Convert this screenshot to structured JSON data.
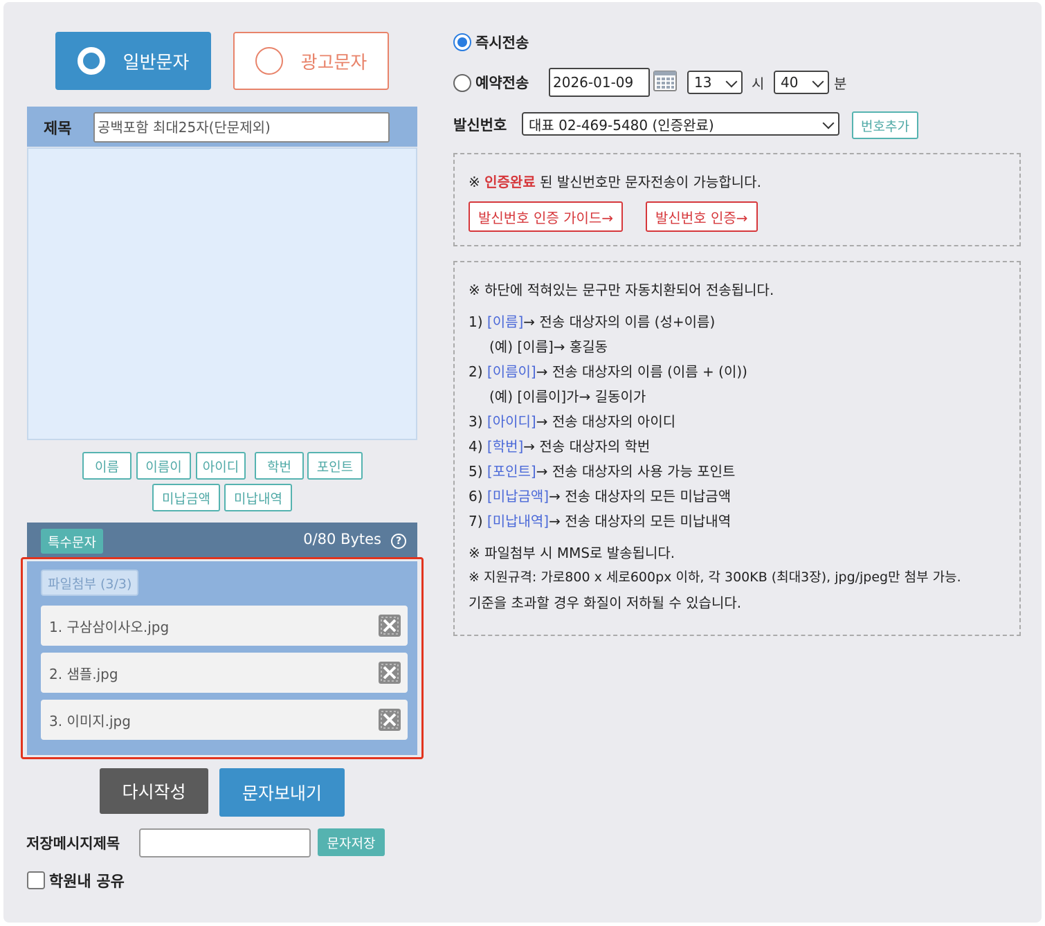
{
  "message_type": {
    "normal_label": "일반문자",
    "ad_label": "광고문자",
    "selected": "일반문자"
  },
  "subject": {
    "label": "제목",
    "placeholder": "공백포함 최대25자(단문제외)"
  },
  "variable_tags": [
    "이름",
    "이름이",
    "아이디",
    "학번",
    "포인트",
    "미납금액",
    "미납내역"
  ],
  "bytes_bar": {
    "special_chars_label": "특수문자",
    "bytes_text": "0/80 Bytes",
    "help_icon": "question-circle-icon"
  },
  "attachments": {
    "badge": "파일첨부 (3/3)",
    "files": [
      "1. 구삼삼이사오.jpg",
      "2. 샘플.jpg",
      "3. 이미지.jpg"
    ],
    "delete_icon": "x-delete-icon"
  },
  "actions": {
    "rewrite_label": "다시작성",
    "send_label": "문자보내기"
  },
  "save_message": {
    "label": "저장메시지제목",
    "value": "",
    "button_label": "문자저장"
  },
  "share": {
    "label": "학원내 공유",
    "checked": false
  },
  "send_mode": {
    "now_label": "즉시전송",
    "reserve_label": "예약전송",
    "selected": "즉시전송",
    "date": "2026-01-09",
    "hour": "13",
    "hour_unit": "시",
    "minute": "40",
    "minute_unit": "분",
    "calendar_icon": "calendar-icon"
  },
  "sender": {
    "label": "발신번호",
    "selected": "대표 02-469-5480 (인증완료)",
    "add_button_label": "번호추가"
  },
  "notice": {
    "prefix": "※ ",
    "highlight": "인증완료",
    "suffix": " 된 발신번호만 문자전송이 가능합니다.",
    "guide_button": "발신번호 인증 가이드→",
    "verify_button": "발신번호 인증→"
  },
  "rules": {
    "intro": "※ 하단에 적혀있는 문구만 자동치환되어 전송됩니다.",
    "items": [
      {
        "num": "1)",
        "tag": "[이름]",
        "desc": "→ 전송 대상자의 이름 (성+이름)"
      },
      {
        "num": "2)",
        "tag": "[이름이]",
        "desc": "→ 전송 대상자의 이름 (이름 + (이))"
      },
      {
        "num": "3)",
        "tag": "[아이디]",
        "desc": "→ 전송 대상자의 아이디"
      },
      {
        "num": "4)",
        "tag": "[학번]",
        "desc": "→ 전송 대상자의 학번"
      },
      {
        "num": "5)",
        "tag": "[포인트]",
        "desc": "→ 전송 대상자의 사용 가능 포인트"
      },
      {
        "num": "6)",
        "tag": "[미납금액]",
        "desc": "→ 전송 대상자의 모든 미납금액"
      },
      {
        "num": "7)",
        "tag": "[미납내역]",
        "desc": "→ 전송 대상자의 모든 미납내역"
      }
    ],
    "example1": "(예) [이름]→ 홍길동",
    "example2": "(예) [이름이]가→ 길동이가",
    "file_note": "※ 파일첨부 시 MMS로 발송됩니다.",
    "spec_note": "※ 지원규격: 가로800 x 세로600px 이하, 각 300KB (최대3장), jpg/jpeg만 첨부 가능.",
    "quality_note": "기준을 초과할 경우 화질이 저하될 수 있습니다."
  },
  "colors": {
    "primary_blue": "#3b90c9",
    "ad_orange": "#e8836a",
    "teal": "#55b3b0",
    "notice_red": "#d6373b",
    "tag_blue": "#4a68d8",
    "highlight_outline": "#e2341e"
  }
}
